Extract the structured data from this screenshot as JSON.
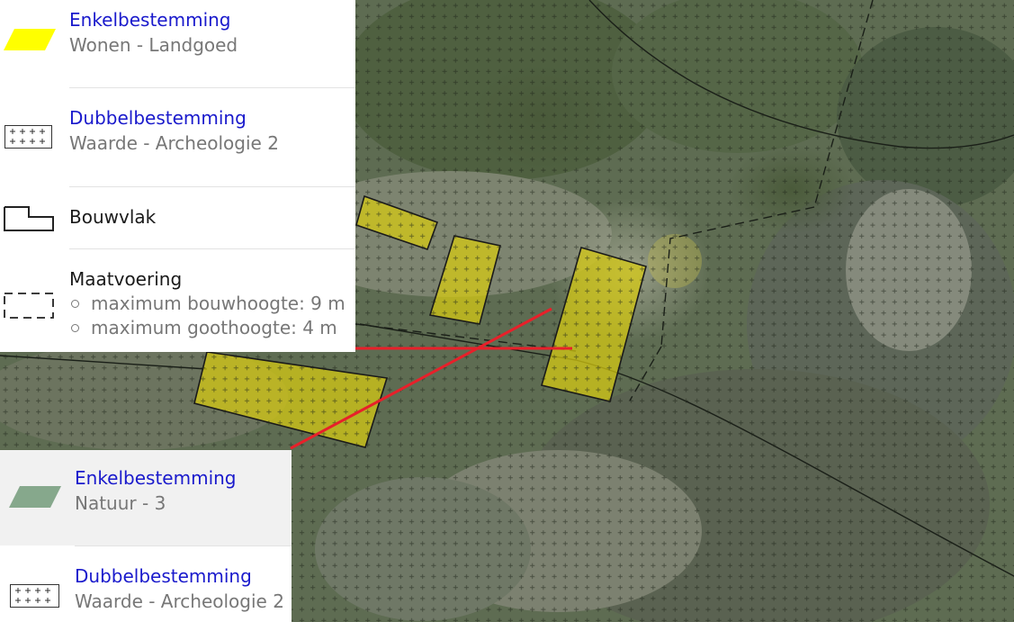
{
  "legend_top": {
    "items": [
      {
        "kind": "Enkelbestemming",
        "value": "Wonen - Landgoed",
        "swatch": "#ffff00"
      },
      {
        "kind": "Dubbelbestemming",
        "value": "Waarde - Archeologie 2"
      },
      {
        "label": "Bouwvlak"
      },
      {
        "label": "Maatvoering",
        "bullets": [
          "maximum bouwhoogte: 9 m",
          "maximum goothoogte: 4 m"
        ]
      }
    ]
  },
  "legend_bottom": {
    "items": [
      {
        "kind": "Enkelbestemming",
        "value": "Natuur - 3",
        "swatch": "#86a88c"
      },
      {
        "kind": "Dubbelbestemming",
        "value": "Waarde - Archeologie 2"
      }
    ]
  },
  "colors": {
    "link_blue": "#1a1acc",
    "leader_line": "#e8202a",
    "building_fill": "#d8cc10",
    "aerial_base": "#5d6c52"
  },
  "icons": [
    "yellow-parallelogram-icon",
    "crosshatch-plus-icon",
    "bouwvlak-outline-icon",
    "dashed-rectangle-icon",
    "green-parallelogram-icon"
  ]
}
